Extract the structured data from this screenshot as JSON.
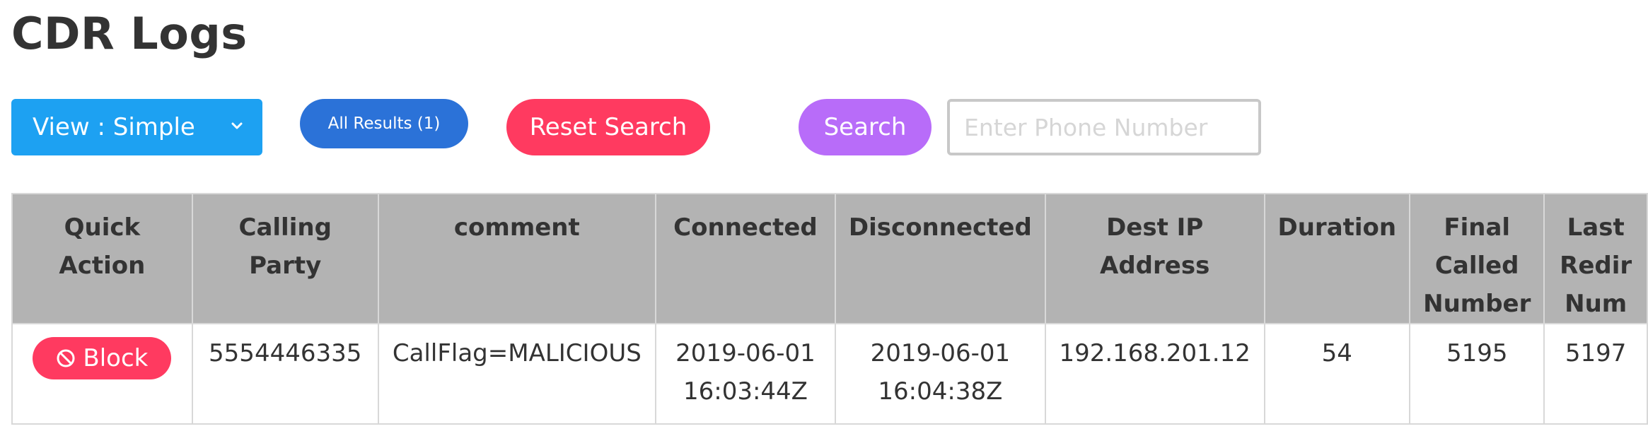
{
  "page": {
    "title": "CDR Logs"
  },
  "toolbar": {
    "view_label": "View : Simple",
    "all_results_label": "All Results (1)",
    "reset_label": "Reset Search",
    "search_label": "Search",
    "phone_placeholder": "Enter Phone Number",
    "phone_value": ""
  },
  "colors": {
    "view_button": "#1da1f2",
    "all_results_button": "#2b72d8",
    "reset_button": "#ff3a60",
    "search_button": "#b86cf9",
    "block_button": "#ff3a60",
    "header_background": "#b3b3b3"
  },
  "icons": {
    "view_dropdown": "chevron-down-icon",
    "block": "block-icon"
  },
  "table": {
    "headers": {
      "quick_action": "Quick Action",
      "calling_party": "Calling Party",
      "comment": "comment",
      "connected": "Connected",
      "disconnected": "Disconnected",
      "dest_ip": "Dest IP Address",
      "duration": "Duration",
      "final_called": "Final Called Number",
      "last_redir": "Last Redir Num"
    },
    "rows": [
      {
        "action_label": "Block",
        "calling_party": "5554446335",
        "comment": "CallFlag=MALICIOUS",
        "connected_date": "2019-06-01",
        "connected_time": "16:03:44Z",
        "disconnected_date": "2019-06-01",
        "disconnected_time": "16:04:38Z",
        "dest_ip": "192.168.201.12",
        "duration": "54",
        "final_called": "5195",
        "last_redir": "5197"
      }
    ]
  }
}
